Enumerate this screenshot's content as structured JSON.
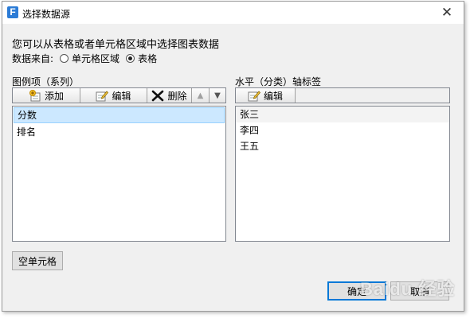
{
  "window": {
    "app_icon_letter": "F",
    "title": "选择数据源",
    "close_glyph": "✕"
  },
  "prompt": "您可以从表格或者单元格区域中选择图表数据",
  "source": {
    "label": "数据来自:",
    "options": [
      {
        "label": "单元格区域",
        "selected": false
      },
      {
        "label": "表格",
        "selected": true
      }
    ]
  },
  "legend": {
    "label": "图例项（系列）",
    "toolbar": {
      "add": "添加",
      "edit": "编辑",
      "delete": "删除",
      "up_glyph": "▲",
      "down_glyph": "▼"
    },
    "items": [
      {
        "label": "分数",
        "selected": true
      },
      {
        "label": "排名",
        "selected": false
      }
    ]
  },
  "axis": {
    "label": "水平（分类）轴标签",
    "toolbar": {
      "edit": "编辑"
    },
    "items": [
      {
        "label": "张三"
      },
      {
        "label": "李四"
      },
      {
        "label": "王五"
      }
    ]
  },
  "buttons": {
    "empty_cells": "空单元格",
    "ok": "确定",
    "cancel": "取消"
  },
  "watermark": "Baidu 经验",
  "colors": {
    "selection": "#cce8ff",
    "default_button_border": "#0078d7",
    "app_icon": "#2b7bd6"
  }
}
